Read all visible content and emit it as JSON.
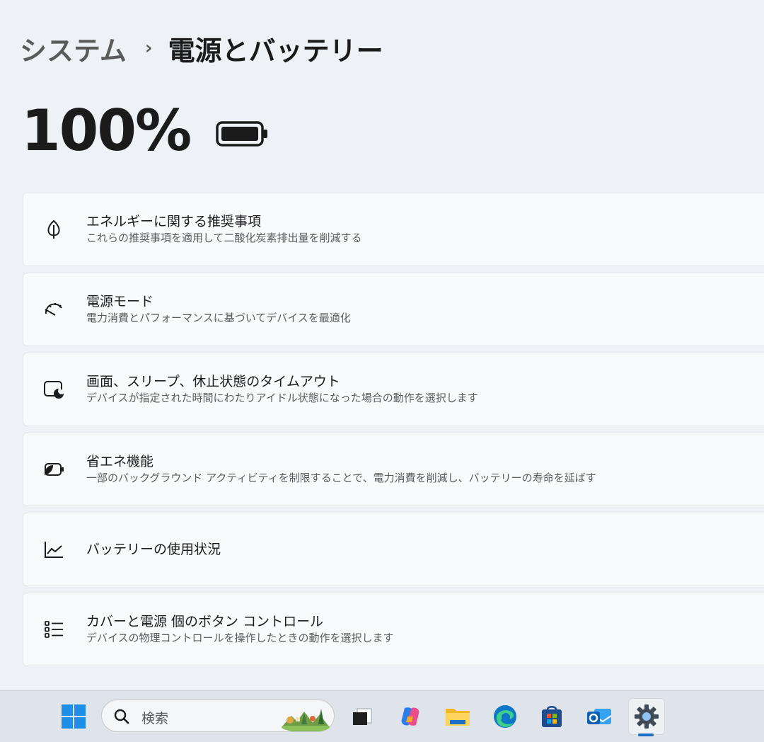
{
  "breadcrumb": {
    "parent": "システム",
    "separator": "›",
    "current": "電源とバッテリー"
  },
  "battery": {
    "percent_text": "100%",
    "level": 1.0
  },
  "cards": [
    {
      "icon": "leaf-icon",
      "title": "エネルギーに関する推奨事項",
      "description": "これらの推奨事項を適用して二酸化炭素排出量を削減する"
    },
    {
      "icon": "power-mode-gauge-icon",
      "title": "電源モード",
      "description": "電力消費とパフォーマンスに基づいてデバイスを最適化"
    },
    {
      "icon": "screen-sleep-icon",
      "title": "画面、スリープ、休止状態のタイムアウト",
      "description": "デバイスが指定された時間にわたりアイドル状態になった場合の動作を選択します"
    },
    {
      "icon": "energy-saver-icon",
      "title": "省エネ機能",
      "description": "一部のバックグラウンド アクティビティを制限することで、電力消費を削減し、バッテリーの寿命を延ばす"
    },
    {
      "icon": "chart-line-icon",
      "title": "バッテリーの使用状況",
      "description": ""
    },
    {
      "icon": "list-settings-icon",
      "title": "カバーと電源 個のボタン コントロール",
      "description": "デバイスの物理コントロールを操作したときの動作を選択します"
    }
  ],
  "taskbar": {
    "search_label": "検索",
    "apps": [
      "start-icon",
      "task-view-icon",
      "copilot-icon",
      "file-explorer-icon",
      "edge-icon",
      "store-icon",
      "outlook-icon",
      "settings-icon"
    ],
    "active_app": "settings-icon",
    "accent_color": "#1a6fc4"
  }
}
